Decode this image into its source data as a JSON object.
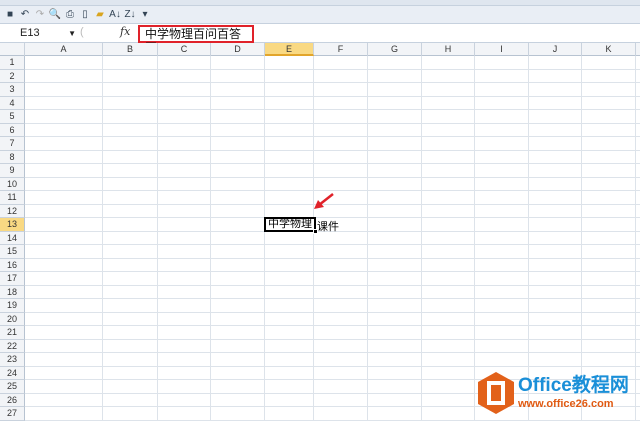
{
  "quick_access": {
    "icons": [
      "save-icon",
      "undo-icon",
      "redo-icon",
      "print-preview-icon",
      "print-icon",
      "new-icon",
      "open-icon",
      "sort-ascending-icon",
      "sort-descending-icon",
      "customize-icon"
    ]
  },
  "formula_bar": {
    "name_box": "E13",
    "fx_label": "fx",
    "value": "中学物理百问百答网"
  },
  "columns": [
    "A",
    "B",
    "C",
    "D",
    "E",
    "F",
    "G",
    "H",
    "I",
    "J",
    "K"
  ],
  "selected_column": "E",
  "rows": [
    "1",
    "2",
    "3",
    "4",
    "5",
    "6",
    "7",
    "8",
    "9",
    "10",
    "11",
    "12",
    "13",
    "14",
    "15",
    "16",
    "17",
    "18",
    "19",
    "20",
    "21",
    "22",
    "23",
    "24",
    "25",
    "26",
    "27"
  ],
  "selected_row": "13",
  "active_cell": {
    "display": "中学物理",
    "overflow_text": "课件"
  },
  "watermark": {
    "brand": "Office教程网",
    "url": "www.office26.com"
  },
  "colors": {
    "highlight": "#e0222a",
    "header_selected": "#f9d983",
    "brand_blue": "#1a8fd8",
    "brand_orange": "#e05a12"
  }
}
